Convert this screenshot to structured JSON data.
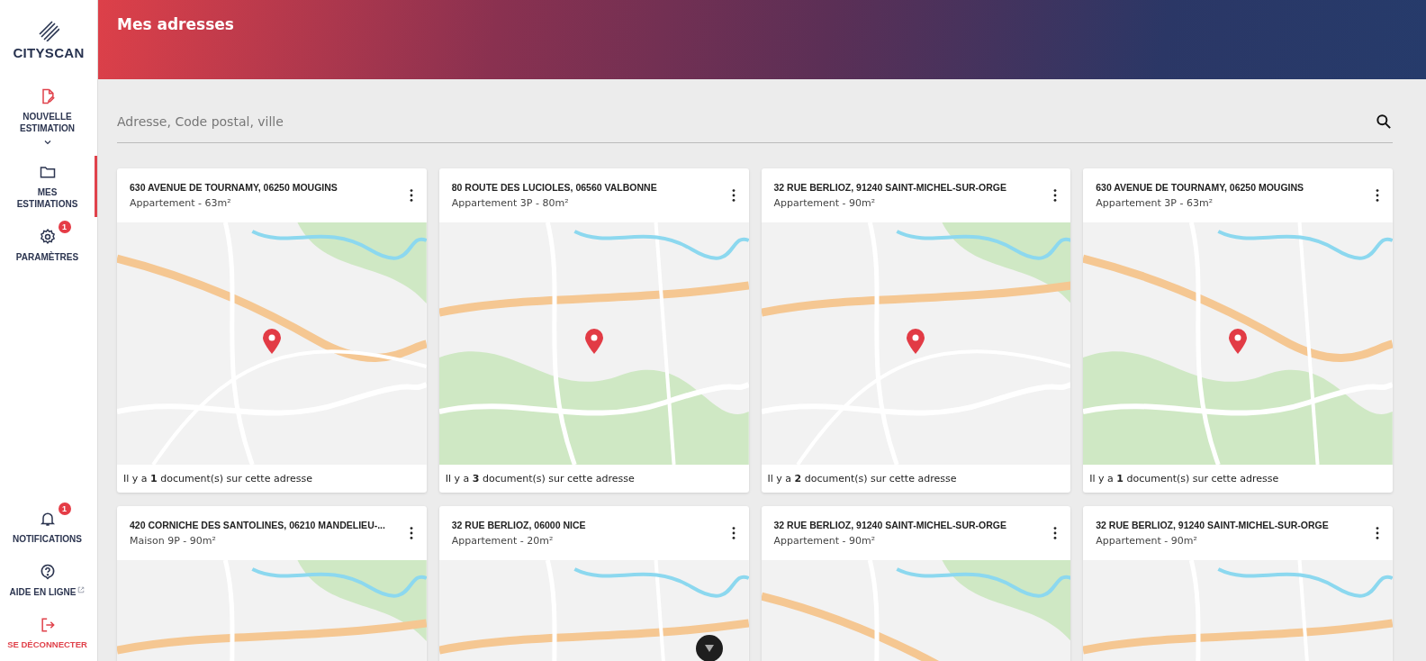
{
  "sidebar": {
    "logo": "CITYSCAN",
    "top_items": [
      {
        "label": "NOUVELLE ESTIMATION",
        "selected": false,
        "kind": "create"
      },
      {
        "label": "MES ESTIMATIONS",
        "selected": true,
        "kind": "plain"
      },
      {
        "label": "PARAMÈTRES",
        "selected": false,
        "kind": "plain",
        "badge": "1"
      }
    ],
    "bottom_items": [
      {
        "label": "NOTIFICATIONS",
        "selected": false,
        "kind": "plain",
        "badge": "1"
      },
      {
        "label": "AIDE EN LIGNE",
        "selected": false,
        "kind": "external"
      },
      {
        "label": "SE DÉCONNECTER",
        "selected": false,
        "kind": "danger"
      }
    ]
  },
  "header": {
    "title": "Mes adresses"
  },
  "search": {
    "placeholder": "Adresse, Code postal, ville"
  },
  "cards": [
    {
      "address": "630 AVENUE DE TOURNAMY, 06250 MOUGINS",
      "details": "Appartement - 63m²",
      "documents": "Il y a **1** document(s) sur cette adresse"
    },
    {
      "address": "80 ROUTE DES LUCIOLES, 06560 VALBONNE",
      "details": "Appartement 3P - 80m²",
      "documents": "Il y a **3** document(s) sur cette adresse"
    },
    {
      "address": "32 RUE BERLIOZ, 91240 SAINT-MICHEL-SUR-ORGE",
      "details": "Appartement - 90m²",
      "documents": "Il y a **2** document(s) sur cette adresse"
    },
    {
      "address": "630 AVENUE DE TOURNAMY, 06250 MOUGINS",
      "details": "Appartement 3P - 63m²",
      "documents": "Il y a **1** document(s) sur cette adresse"
    },
    {
      "address": "420 CORNICHE DES SANTOLINES, 06210 MANDELIEU-...",
      "details": "Maison 9P - 90m²"
    },
    {
      "address": "32 RUE BERLIOZ, 06000 NICE",
      "details": "Appartement - 20m²"
    },
    {
      "address": "32 RUE BERLIOZ, 91240 SAINT-MICHEL-SUR-ORGE",
      "details": "Appartement - 90m²"
    },
    {
      "address": "32 RUE BERLIOZ, 91240 SAINT-MICHEL-SUR-ORGE",
      "details": "Appartement - 90m²"
    }
  ]
}
